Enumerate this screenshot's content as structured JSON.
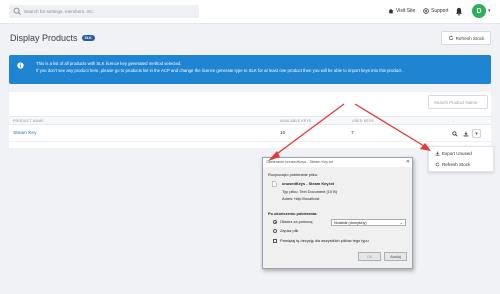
{
  "topbar": {
    "search_placeholder": "Search for settings, members, etc.",
    "visit_site": "Visit Site",
    "support": "Support",
    "avatar_initial": "D"
  },
  "page": {
    "title": "Display Products",
    "badge": "SLK",
    "refresh_label": "Refresh Stock"
  },
  "alert": {
    "line1": "This is a list of all products with SLK licence key generated method selected.",
    "line2": "If you don't see any product here, please go to products list in the ACP and change the licence generate type to SLK for at least one product then you will be able to import keys into this product."
  },
  "table": {
    "search_placeholder": "Search Product Name",
    "headers": [
      "PRODUCT NAME",
      "AVAILABLE KEYS",
      "USED KEYS",
      "-"
    ],
    "rows": [
      {
        "product": "Steam Key",
        "available": "10",
        "used": "7"
      }
    ]
  },
  "dropdown": {
    "items": [
      {
        "label": "Export Unused",
        "icon": "download-icon"
      },
      {
        "label": "Refresh Stock",
        "icon": "refresh-icon"
      }
    ]
  },
  "dialog": {
    "title": "Otwieranie unusedKeys - Steam Key.txt",
    "intro": "Rozpoczęto pobieranie pliku:",
    "filename": "unusedKeys - Steam Key.txt",
    "type_line": "Typ pliku: Text Document (10 B)",
    "address_line": "Adres: http://localhost",
    "section": "Po ukończeniu pobierania:",
    "open_with": "Otwórz za pomocą",
    "app_selected": "Notatnik (domyślny)",
    "save_file": "Zapisz plik",
    "remember": "Pamiętaj tę decyzję dla wszystkich plików tego typu",
    "ok": "OK",
    "cancel": "Anuluj"
  },
  "colors": {
    "alert_bg": "#1f84d1",
    "avatar_bg": "#2cae5a",
    "badge_bg": "#2b5a9e",
    "arrow_red": "#e03a3a"
  }
}
